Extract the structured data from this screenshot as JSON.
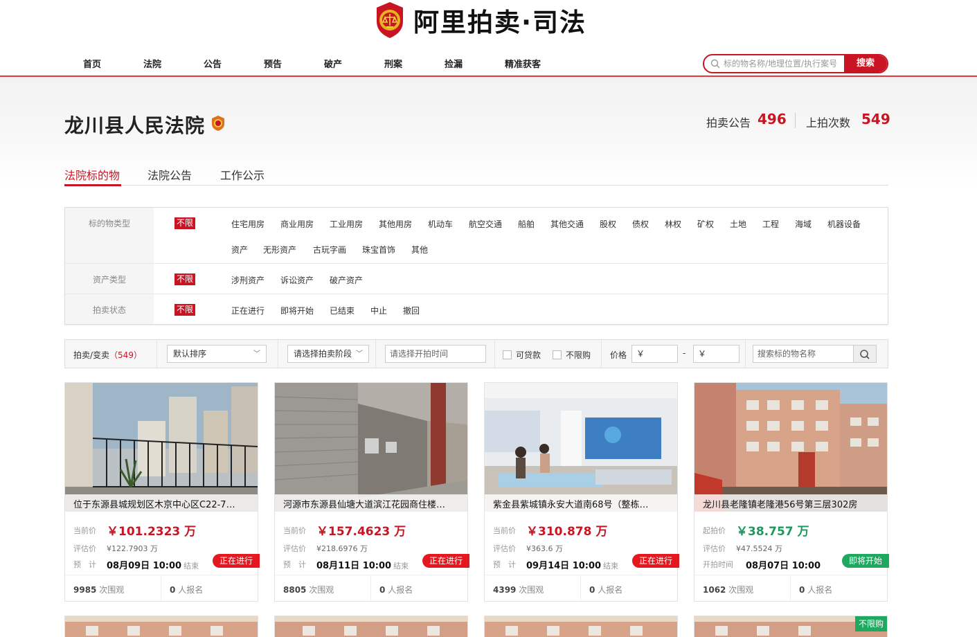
{
  "brand": {
    "name": "阿里拍卖·司法"
  },
  "nav": {
    "items": [
      "首页",
      "法院",
      "公告",
      "预告",
      "破产",
      "刑案",
      "捡漏",
      "精准获客"
    ]
  },
  "search": {
    "placeholder": "标的物名称/地理位置/执行案号",
    "button": "搜索"
  },
  "court": {
    "name": "龙川县人民法院",
    "stats": [
      {
        "label": "拍卖公告",
        "value": "496"
      },
      {
        "label": "上拍次数",
        "value": "549"
      }
    ]
  },
  "tabs": [
    "法院标的物",
    "法院公告",
    "工作公示"
  ],
  "filters": {
    "all_label": "不限",
    "rows": [
      {
        "label": "标的物类型",
        "options": [
          "住宅用房",
          "商业用房",
          "工业用房",
          "其他用房",
          "机动车",
          "航空交通",
          "船舶",
          "其他交通",
          "股权",
          "债权",
          "林权",
          "矿权",
          "土地",
          "工程",
          "海域",
          "机器设备",
          "资产",
          "无形资产",
          "古玩字画",
          "珠宝首饰",
          "其他"
        ]
      },
      {
        "label": "资产类型",
        "options": [
          "涉刑资产",
          "诉讼资产",
          "破产资产"
        ]
      },
      {
        "label": "拍卖状态",
        "options": [
          "正在进行",
          "即将开始",
          "已结束",
          "中止",
          "撤回"
        ]
      }
    ]
  },
  "toolbar": {
    "mode_label": "拍卖/变卖",
    "count": "（549）",
    "sort": "默认排序",
    "stage_placeholder": "请选择拍卖阶段",
    "time_placeholder": "请选择开拍时间",
    "loanable": "可贷款",
    "unrestricted": "不限购",
    "price_label": "价格",
    "price_min": "￥",
    "price_dash": "-",
    "price_max": "￥",
    "keyword_placeholder": "搜索标的物名称"
  },
  "cards": [
    {
      "title": "位于东源县城规划区木京中心区C22-7…",
      "price_label": "当前价",
      "price": "￥101.2323 万",
      "appraisal_label": "评估价",
      "appraisal": "¥122.7903 万",
      "time_label": "预　计",
      "time": "08月09日 10:00",
      "time_suffix": "结束",
      "status": "正在进行",
      "views": "9985",
      "views_label": "次围观",
      "signups": "0",
      "signups_label": "人报名"
    },
    {
      "title": "河源市东源县仙塘大道滨江花园商住楼…",
      "price_label": "当前价",
      "price": "￥157.4623 万",
      "appraisal_label": "评估价",
      "appraisal": "¥218.6976 万",
      "time_label": "预　计",
      "time": "08月11日 10:00",
      "time_suffix": "结束",
      "status": "正在进行",
      "views": "8805",
      "views_label": "次围观",
      "signups": "0",
      "signups_label": "人报名"
    },
    {
      "title": "紫金县紫城镇永安大道南68号（整栋…",
      "price_label": "当前价",
      "price": "￥310.878 万",
      "appraisal_label": "评估价",
      "appraisal": "¥363.6 万",
      "time_label": "预　计",
      "time": "09月14日 10:00",
      "time_suffix": "结束",
      "status": "正在进行",
      "views": "4399",
      "views_label": "次围观",
      "signups": "0",
      "signups_label": "人报名"
    },
    {
      "title": "龙川县老隆镇老隆港56号第三层302房",
      "price_label": "起拍价",
      "price": "￥38.757 万",
      "appraisal_label": "评估价",
      "appraisal": "¥47.5524 万",
      "time_label": "开拍时间",
      "time": "08月07日 10:00",
      "time_suffix": "",
      "status": "即将开始",
      "views": "1062",
      "views_label": "次围观",
      "signups": "0",
      "signups_label": "人报名"
    }
  ],
  "next_row": {
    "badge": "不限购"
  },
  "colors": {
    "accent": "#c91523",
    "status_live": "#e4181e",
    "status_soon": "#1ea860"
  }
}
